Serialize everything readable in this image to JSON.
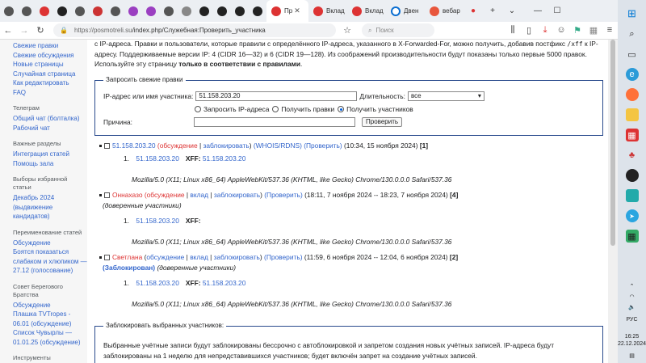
{
  "browser": {
    "tabs": [
      {
        "label": "",
        "icon": "globe-icon",
        "color": "#555"
      },
      {
        "label": "",
        "icon": "globe-icon",
        "color": "#555"
      },
      {
        "label": "",
        "icon": "a-icon",
        "color": "#d33"
      },
      {
        "label": "",
        "icon": "x-icon",
        "color": "#222"
      },
      {
        "label": "",
        "icon": "globe-icon",
        "color": "#555"
      },
      {
        "label": "",
        "icon": "image-icon",
        "color": "#c33"
      },
      {
        "label": "",
        "icon": "globe-icon",
        "color": "#555"
      },
      {
        "label": "",
        "icon": "m-icon",
        "color": "#9b3fc1"
      },
      {
        "label": "",
        "icon": "m-icon",
        "color": "#9b3fc1"
      },
      {
        "label": "",
        "icon": "globe-icon",
        "color": "#555"
      },
      {
        "label": "",
        "icon": "image-icon",
        "color": "#888"
      },
      {
        "label": "",
        "icon": "s-icon",
        "color": "#222"
      },
      {
        "label": "",
        "icon": "warning-icon",
        "color": "#222"
      },
      {
        "label": "",
        "icon": "circle-icon",
        "color": "#222"
      },
      {
        "label": "",
        "icon": "warning-icon",
        "color": "#222"
      }
    ],
    "active_tab": "Пр",
    "tab2": "Вклад",
    "tab3": "Вклад",
    "tab4": "Двен",
    "tab5": "вебар",
    "url_host": "https://posmotreli.su",
    "url_path": "/index.php/Служебная:Проверить_участника",
    "search_placeholder": "Поиск"
  },
  "sidebar": {
    "items_top": [
      "Свежие правки",
      "Свежие обсуждения",
      "Новые страницы",
      "Случайная страница",
      "Как редактировать",
      "FAQ"
    ],
    "telegram_head": "Телеграм",
    "telegram": [
      "Общий чат (болталка)",
      "Рабочий чат"
    ],
    "important_head": "Важные разделы",
    "important": [
      "Интеграция статей",
      "Помощь зала"
    ],
    "featured_head": "Выборы избранной статьи",
    "featured": "Декабрь 2024 (выдвижение кандидатов)",
    "renaming_head": "Переименование статей",
    "renaming": [
      "Обсуждение",
      "Боятся показаться слабаком и хлюпиком — 27.12 (голосование)"
    ],
    "council_head": "Совет Берегового Братства",
    "council": [
      "Обсуждение",
      "Плашка TVTropes - 06.01 (обсуждение)",
      "Список Чувырлы — 01.01.25 (обсуждение)"
    ],
    "tools_head": "Инструменты"
  },
  "content": {
    "intro_1": "с IP-адреса. Правки и пользователи, которые правили с определённого IP-адреса, указанного в X-Forwarded-For, можно получить, добавив постфикс ",
    "intro_code": "/xff",
    "intro_2": " к IP-адресу. Поддерживаемые версии IP: 4 (CIDR 16—32) и 6 (CIDR 19—128). Из соображений производительности будут показаны только первые 5000 правок. Используйте эту страницу ",
    "intro_bold": "только в соответствии с правилами",
    "intro_end": ".",
    "form": {
      "legend": "Запросить свежие правки",
      "ip_label": "IP-адрес или имя участника:",
      "ip_value": "51.158.203.20",
      "duration_label": "Длительность:",
      "duration_value": "все",
      "opt1": "Запросить IP-адреса",
      "opt2": "Получить правки",
      "opt3": "Получить участников",
      "reason_label": "Причина:",
      "submit": "Проверить"
    },
    "results": [
      {
        "user": "51.158.203.20",
        "links_a": "(",
        "talk": "обсуждение",
        "sep1": " | ",
        "block": "заблокировать",
        "links_b": ") ",
        "extra1": "(WHOIS/RDNS)",
        "check": "(Проверить)",
        "time": "(10:34, 15 ноября 2024)",
        "count": "[1]",
        "blocked": "",
        "note": "",
        "ip": "51.158.203.20",
        "xff_label": "XFF:",
        "xff": "51.158.203.20",
        "ua": "Mozilla/5.0 (X11; Linux x86_64) AppleWebKit/537.36 (KHTML, like Gecko) Chrome/130.0.0.0 Safari/537.36"
      },
      {
        "user": "Оннахазо",
        "talk": "обсуждение",
        "contrib": "вклад",
        "block": "заблокировать",
        "check": "(Проверить)",
        "time": "(18:11, 7 ноября 2024 -- 18:23, 7 ноября 2024)",
        "count": "[4]",
        "note": "(доверенные участники)",
        "ip": "51.158.203.20",
        "xff_label": "XFF:",
        "xff": "",
        "ua": "Mozilla/5.0 (X11; Linux x86_64) AppleWebKit/537.36 (KHTML, like Gecko) Chrome/130.0.0.0 Safari/537.36"
      },
      {
        "user": "Светлана",
        "talk": "обсуждение",
        "contrib": "вклад",
        "block": "заблокировать",
        "check": "(Проверить)",
        "time": "(11:59, 6 ноября 2024 -- 12:04, 6 ноября 2024)",
        "count": "[2]",
        "blocked": "(Заблокирован)",
        "note": "(доверенные участники)",
        "ip": "51.158.203.20",
        "xff_label": "XFF:",
        "xff": "51.158.203.20",
        "ua": "Mozilla/5.0 (X11; Linux x86_64) AppleWebKit/537.36 (KHTML, like Gecko) Chrome/130.0.0.0 Safari/537.36"
      }
    ],
    "block_box": {
      "legend": "Заблокировать выбранных участников:",
      "text": "Выбранные учётные записи будут заблокированы бессрочно с автоблокировкой и запретом создания новых учётных записей. IP-адреса будут заблокированы на 1 неделю для непредставившихся участников; будет включён запрет на создание учётных записей."
    }
  },
  "taskbar": {
    "lang": "РУС",
    "time": "16:25",
    "date": "22.12.2024"
  }
}
